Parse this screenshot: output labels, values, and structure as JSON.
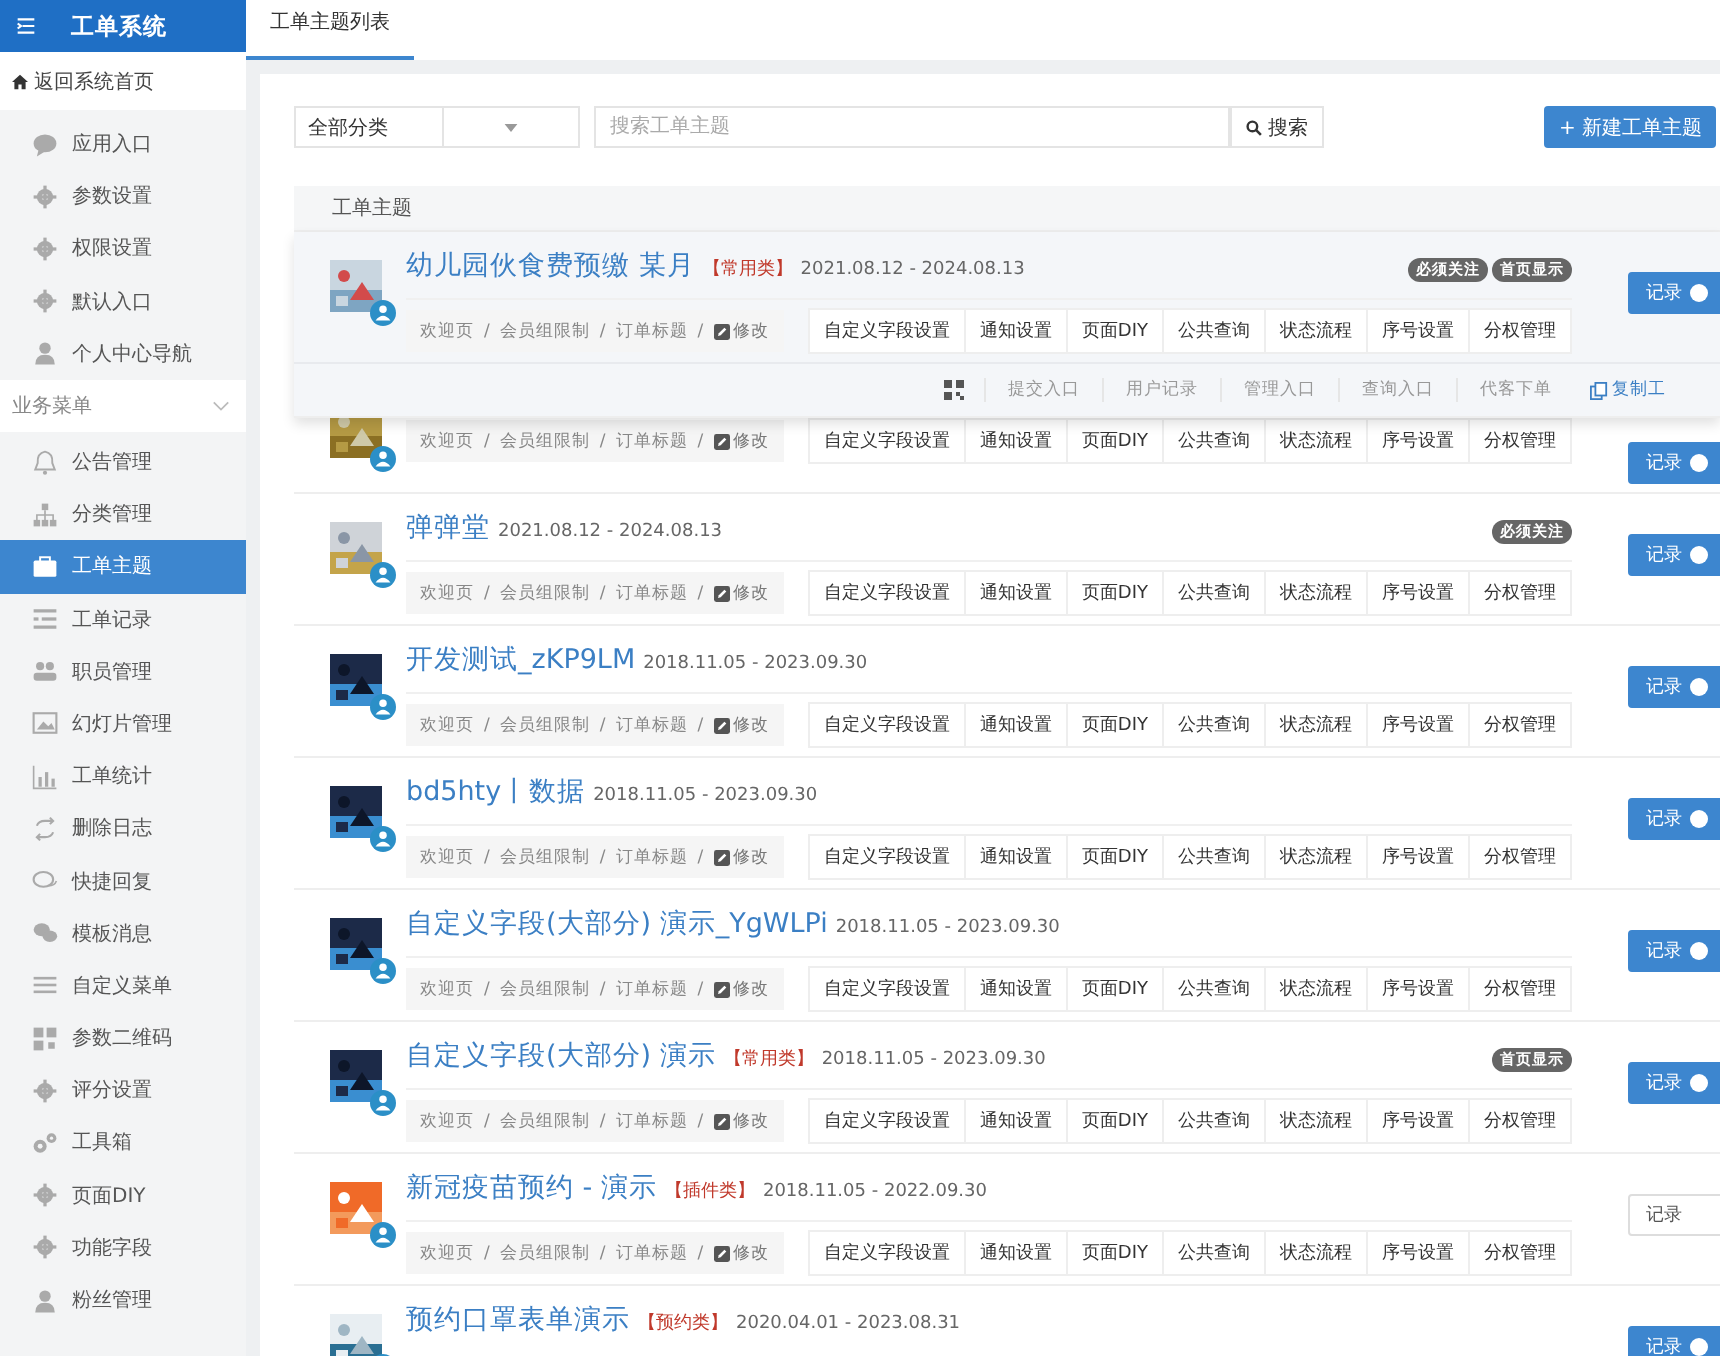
{
  "sidebar": {
    "title": "工单系统",
    "home_link": "返回系统首页",
    "top_items": [
      {
        "label": "应用入口",
        "selected": false
      },
      {
        "label": "参数设置",
        "selected": false
      },
      {
        "label": "权限设置",
        "selected": false
      },
      {
        "label": "默认入口",
        "selected": false
      },
      {
        "label": "个人中心导航",
        "selected": false
      }
    ],
    "section": {
      "label": "业务菜单",
      "expanded": true
    },
    "items": [
      {
        "label": "公告管理",
        "selected": false
      },
      {
        "label": "分类管理",
        "selected": false
      },
      {
        "label": "工单主题",
        "selected": true
      },
      {
        "label": "工单记录",
        "selected": false
      },
      {
        "label": "职员管理",
        "selected": false
      },
      {
        "label": "幻灯片管理",
        "selected": false
      },
      {
        "label": "工单统计",
        "selected": false
      },
      {
        "label": "删除日志",
        "selected": false
      },
      {
        "label": "快捷回复",
        "selected": false
      },
      {
        "label": "模板消息",
        "selected": false
      },
      {
        "label": "自定义菜单",
        "selected": false
      },
      {
        "label": "参数二维码",
        "selected": false
      },
      {
        "label": "评分设置",
        "selected": false
      },
      {
        "label": "工具箱",
        "selected": false
      },
      {
        "label": "页面DIY",
        "selected": false
      },
      {
        "label": "功能字段",
        "selected": false
      },
      {
        "label": "粉丝管理",
        "selected": false
      }
    ]
  },
  "tabs": [
    {
      "label": "工单主题列表",
      "selected": true
    }
  ],
  "filter": {
    "category": "全部分类",
    "search_placeholder": "搜索工单主题",
    "search_button": "搜索",
    "new_button": "+ 新建工单主题"
  },
  "table": {
    "column_header": "工单主题",
    "rows": [
      {
        "title": "幼儿园伙食费预缴 某月",
        "tag": "【常用类】",
        "dates": "2021.08.12 - 2024.08.13",
        "badges": [
          "必须关注",
          "首页显示"
        ],
        "breadcrumbs": [
          "欢迎页",
          "会员组限制",
          "订单标题"
        ],
        "separator": "/",
        "edit": "修改",
        "actions": [
          "自定义字段设置",
          "通知设置",
          "页面DIY",
          "公共查询",
          "状态流程",
          "序号设置",
          "分权管理"
        ],
        "record": {
          "label": "记录",
          "on": true
        },
        "hovered": true,
        "quick_links": [
          "提交入口",
          "用户记录",
          "管理入口",
          "查询入口",
          "代客下单"
        ],
        "copy_link": "复制工"
      },
      {
        "breadcrumbs": [
          "欢迎页",
          "会员组限制",
          "订单标题"
        ],
        "separator": "/",
        "edit": "修改",
        "actions": [
          "自定义字段设置",
          "通知设置",
          "页面DIY",
          "公共查询",
          "状态流程",
          "序号设置",
          "分权管理"
        ],
        "record": {
          "label": "记录",
          "on": true
        },
        "hovered": false
      },
      {
        "title": "弹弹堂",
        "dates": "2021.08.12 - 2024.08.13",
        "badges": [
          "必须关注"
        ],
        "breadcrumbs": [
          "欢迎页",
          "会员组限制",
          "订单标题"
        ],
        "separator": "/",
        "edit": "修改",
        "actions": [
          "自定义字段设置",
          "通知设置",
          "页面DIY",
          "公共查询",
          "状态流程",
          "序号设置",
          "分权管理"
        ],
        "record": {
          "label": "记录",
          "on": true
        },
        "hovered": false
      },
      {
        "title": "开发测试_zKP9LM",
        "dates": "2018.11.05 - 2023.09.30",
        "breadcrumbs": [
          "欢迎页",
          "会员组限制",
          "订单标题"
        ],
        "separator": "/",
        "edit": "修改",
        "actions": [
          "自定义字段设置",
          "通知设置",
          "页面DIY",
          "公共查询",
          "状态流程",
          "序号设置",
          "分权管理"
        ],
        "record": {
          "label": "记录",
          "on": true
        },
        "hovered": false
      },
      {
        "title": "bd5hty丨数据",
        "dates": "2018.11.05 - 2023.09.30",
        "breadcrumbs": [
          "欢迎页",
          "会员组限制",
          "订单标题"
        ],
        "separator": "/",
        "edit": "修改",
        "actions": [
          "自定义字段设置",
          "通知设置",
          "页面DIY",
          "公共查询",
          "状态流程",
          "序号设置",
          "分权管理"
        ],
        "record": {
          "label": "记录",
          "on": true
        },
        "hovered": false
      },
      {
        "title": "自定义字段(大部分) 演示_YgWLPi",
        "dates": "2018.11.05 - 2023.09.30",
        "breadcrumbs": [
          "欢迎页",
          "会员组限制",
          "订单标题"
        ],
        "separator": "/",
        "edit": "修改",
        "actions": [
          "自定义字段设置",
          "通知设置",
          "页面DIY",
          "公共查询",
          "状态流程",
          "序号设置",
          "分权管理"
        ],
        "record": {
          "label": "记录",
          "on": true
        },
        "hovered": false
      },
      {
        "title": "自定义字段(大部分) 演示",
        "tag": "【常用类】",
        "dates": "2018.11.05 - 2023.09.30",
        "badges": [
          "首页显示"
        ],
        "breadcrumbs": [
          "欢迎页",
          "会员组限制",
          "订单标题"
        ],
        "separator": "/",
        "edit": "修改",
        "actions": [
          "自定义字段设置",
          "通知设置",
          "页面DIY",
          "公共查询",
          "状态流程",
          "序号设置",
          "分权管理"
        ],
        "record": {
          "label": "记录",
          "on": true
        },
        "hovered": false
      },
      {
        "title": "新冠疫苗预约 - 演示",
        "tag": "【插件类】",
        "dates": "2018.11.05 - 2022.09.30",
        "breadcrumbs": [
          "欢迎页",
          "会员组限制",
          "订单标题"
        ],
        "separator": "/",
        "edit": "修改",
        "actions": [
          "自定义字段设置",
          "通知设置",
          "页面DIY",
          "公共查询",
          "状态流程",
          "序号设置",
          "分权管理"
        ],
        "record": {
          "label": "记录",
          "on": false
        },
        "hovered": false
      },
      {
        "title": "预约口罩表单演示",
        "tag": "【预约类】",
        "dates": "2020.04.01 - 2023.08.31",
        "record": {
          "label": "记录",
          "on": true
        },
        "hovered": false
      }
    ]
  }
}
